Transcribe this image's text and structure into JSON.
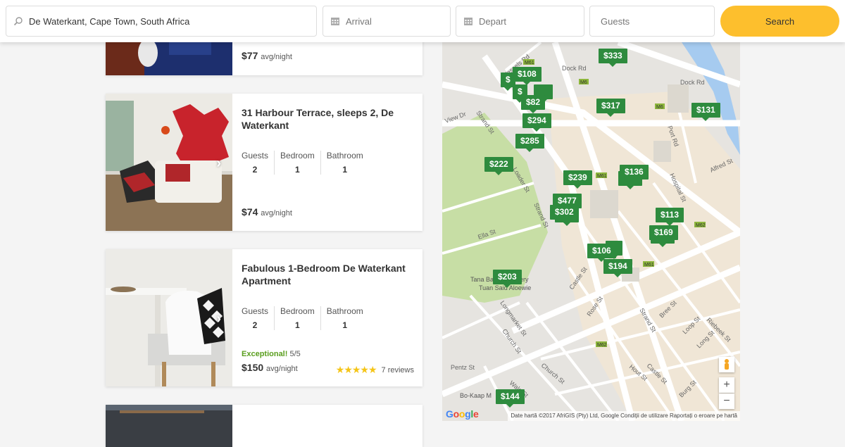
{
  "search": {
    "location_value": "De Waterkant, Cape Town, South Africa",
    "arrival_placeholder": "Arrival",
    "depart_placeholder": "Depart",
    "guests_placeholder": "Guests",
    "button_label": "Search"
  },
  "listings": [
    {
      "title": "",
      "price": "$77",
      "price_unit": "avg/night"
    },
    {
      "title": "31 Harbour Terrace, sleeps 2, De Waterkant",
      "specs": [
        {
          "label": "Guests",
          "value": "2"
        },
        {
          "label": "Bedroom",
          "value": "1"
        },
        {
          "label": "Bathroom",
          "value": "1"
        }
      ],
      "price": "$74",
      "price_unit": "avg/night"
    },
    {
      "title": "Fabulous 1-Bedroom De Waterkant Apartment",
      "specs": [
        {
          "label": "Guests",
          "value": "2"
        },
        {
          "label": "Bedroom",
          "value": "1"
        },
        {
          "label": "Bathroom",
          "value": "1"
        }
      ],
      "rating_label": "Exceptional!",
      "rating_score": "5/5",
      "stars": "★★★★★",
      "reviews": "7 reviews",
      "price": "$150",
      "price_unit": "avg/night"
    }
  ],
  "map": {
    "markers": [
      "$333",
      "$108",
      "$82",
      "$294",
      "$285",
      "$317",
      "$131",
      "$222",
      "$239",
      "$136",
      "$477",
      "$302",
      "$113",
      "$169",
      "$106",
      "$194",
      "$203",
      "$144"
    ],
    "street_labels": [
      "Wessels Rd",
      "Dock Rd",
      "Strand St",
      "Buitengracht St",
      "Loader St",
      "Hospital St",
      "Alfred St",
      "Port Rd",
      "Ella St",
      "Castle St",
      "Rose St",
      "Longmarket St",
      "Church St",
      "Wale St",
      "Pentz St",
      "Bree St",
      "Loop St",
      "Long St",
      "Riebeek St",
      "Hout St",
      "Burg St"
    ],
    "poi_labels": [
      "Tana Baru Cemetery",
      "Tuan Said Aloewie",
      "Bo-Kaap M"
    ],
    "zoom_in": "+",
    "zoom_out": "−",
    "logo": "Google",
    "attribution": "Date hartă ©2017 AfriGIS (Pty) Ltd, Google   Condiții de utilizare   Raportați o eroare pe hartă"
  }
}
